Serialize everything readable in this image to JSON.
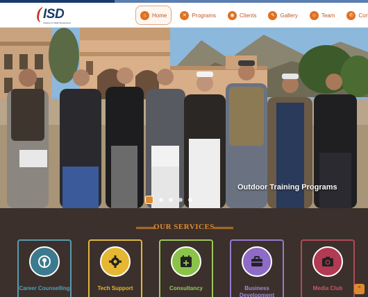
{
  "brand": {
    "logo_text": "ISD",
    "logo_mark": "(",
    "logo_tagline": "Institute for Skills Development"
  },
  "nav": {
    "items": [
      {
        "label": "Home",
        "icon": "home-icon",
        "glyph": "⌂",
        "active": true
      },
      {
        "label": "Programs",
        "icon": "programs-icon",
        "glyph": "✕",
        "active": false
      },
      {
        "label": "Clients",
        "icon": "clients-icon",
        "glyph": "◉",
        "active": false
      },
      {
        "label": "Gallery",
        "icon": "gallery-icon",
        "glyph": "✎",
        "active": false
      },
      {
        "label": "Team",
        "icon": "team-icon",
        "glyph": "☺",
        "active": false
      },
      {
        "label": "Contact",
        "icon": "contact-icon",
        "glyph": "✆",
        "active": false
      }
    ]
  },
  "hero": {
    "caption": "Outdoor Training Programs",
    "slides_count": 5,
    "active_slide": 1
  },
  "services": {
    "title": "OUR SERVICES",
    "cards": [
      {
        "label": "Career Counselling",
        "icon": "mic-icon",
        "glyph": "◎",
        "color": "#5a9bb0",
        "circle": "#3b7a8f",
        "text_color": "#4fa3b8"
      },
      {
        "label": "Tech Support",
        "icon": "gear-icon",
        "glyph": "⚙",
        "color": "#e0b840",
        "circle": "#e6b732",
        "text_color": "#e6b732"
      },
      {
        "label": "Consultancy",
        "icon": "calendar-plus-icon",
        "glyph": "⊞",
        "color": "#9cc85a",
        "circle": "#8bc34a",
        "text_color": "#9cc85a"
      },
      {
        "label": "Business Development",
        "icon": "briefcase-icon",
        "glyph": "■",
        "color": "#9a7ad0",
        "circle": "#8e6bc7",
        "text_color": "#a889dd"
      },
      {
        "label": "Media Club",
        "icon": "camera-icon",
        "glyph": "◙",
        "color": "#b04a5a",
        "circle": "#b23a52",
        "text_color": "#c85a6a"
      }
    ]
  },
  "back_to_top": {
    "icon": "chevron-up-icon",
    "glyph": "⌃"
  }
}
